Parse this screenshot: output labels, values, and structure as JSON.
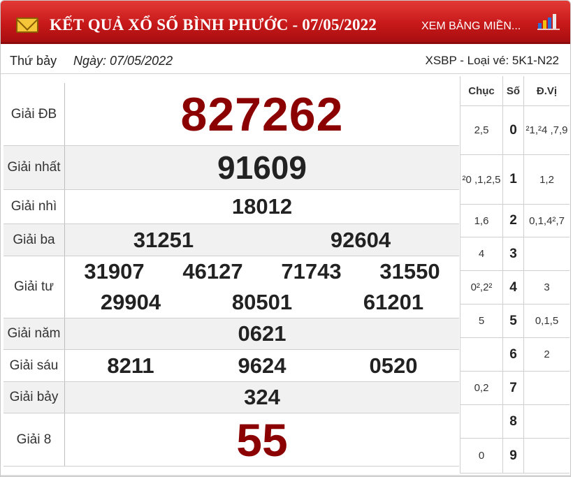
{
  "header": {
    "title": "KẾT QUẢ XỔ SỐ BÌNH PHƯỚC - 07/05/2022",
    "region_link": "XEM BẢNG MIỀN...",
    "colors": {
      "bar": "#c8191a",
      "accent": "#8b0000"
    },
    "icons": [
      "mail-icon",
      "bar-chart-icon"
    ]
  },
  "info": {
    "day": "Thứ bảy",
    "date": "Ngày: 07/05/2022",
    "code": "XSBP - Loại vé: 5K1-N22"
  },
  "prizes": [
    {
      "label": "Giải ĐB",
      "numbers": [
        "827262"
      ]
    },
    {
      "label": "Giải nhất",
      "numbers": [
        "91609"
      ]
    },
    {
      "label": "Giải nhì",
      "numbers": [
        "18012"
      ]
    },
    {
      "label": "Giải ba",
      "numbers": [
        "31251",
        "92604"
      ]
    },
    {
      "label": "Giải tư",
      "numbers": [
        "31907",
        "46127",
        "71743",
        "31550",
        "29904",
        "80501",
        "61201"
      ]
    },
    {
      "label": "Giải năm",
      "numbers": [
        "0621"
      ]
    },
    {
      "label": "Giải sáu",
      "numbers": [
        "8211",
        "9624",
        "0520"
      ]
    },
    {
      "label": "Giải bảy",
      "numbers": [
        "324"
      ]
    },
    {
      "label": "Giải 8",
      "numbers": [
        "55"
      ]
    }
  ],
  "loto": {
    "headers": {
      "chuc": "Chục",
      "so": "Số",
      "dvi": "Đ.Vị"
    },
    "rows": [
      {
        "chuc": "2,5",
        "so": "0",
        "dvi": "²1,²4 ,7,9"
      },
      {
        "chuc": "²0 ,1,2,5",
        "so": "1",
        "dvi": "1,2"
      },
      {
        "chuc": "1,6",
        "so": "2",
        "dvi": "0,1,4²,7"
      },
      {
        "chuc": "4",
        "so": "3",
        "dvi": ""
      },
      {
        "chuc": "0²,2²",
        "so": "4",
        "dvi": "3"
      },
      {
        "chuc": "5",
        "so": "5",
        "dvi": "0,1,5"
      },
      {
        "chuc": "",
        "so": "6",
        "dvi": "2"
      },
      {
        "chuc": "0,2",
        "so": "7",
        "dvi": ""
      },
      {
        "chuc": "",
        "so": "8",
        "dvi": ""
      },
      {
        "chuc": "0",
        "so": "9",
        "dvi": ""
      }
    ]
  }
}
